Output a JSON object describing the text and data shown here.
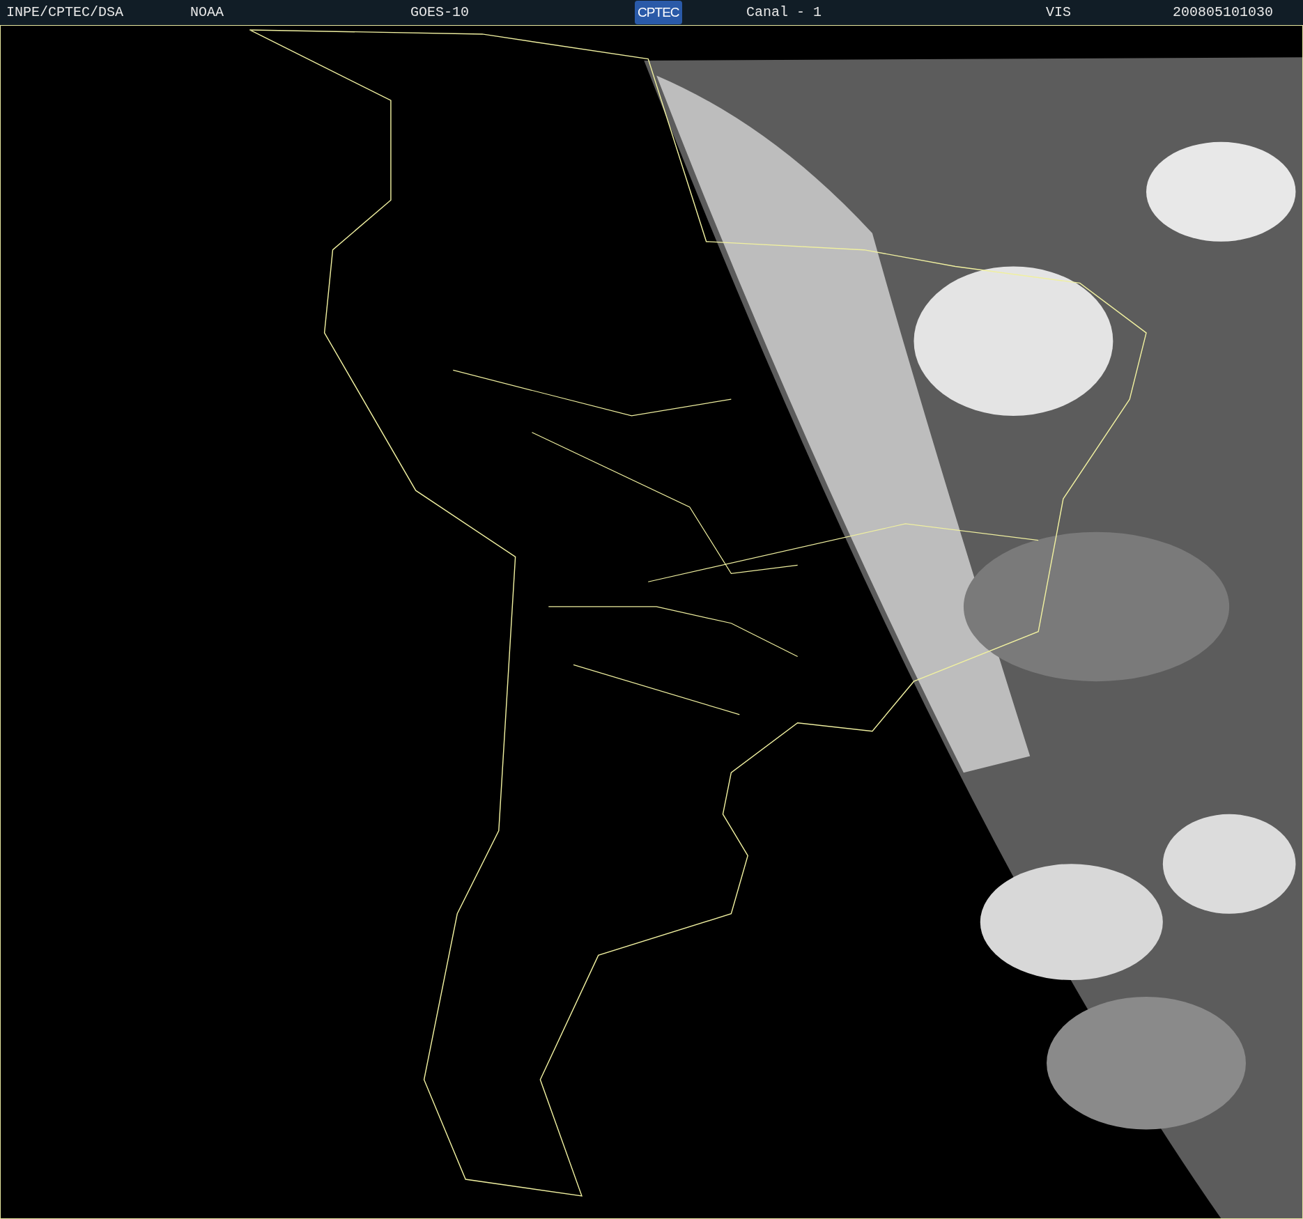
{
  "header": {
    "items": [
      {
        "kind": "text",
        "text": "INPE/CPTEC/DSA"
      },
      {
        "kind": "text",
        "text": "NOAA"
      },
      {
        "kind": "text",
        "text": "GOES-10"
      },
      {
        "kind": "logo",
        "text": "CPTEC"
      },
      {
        "kind": "text",
        "text": "Canal - 1"
      },
      {
        "kind": "text",
        "text": "VIS"
      },
      {
        "kind": "text",
        "text": "200805101030"
      }
    ]
  }
}
